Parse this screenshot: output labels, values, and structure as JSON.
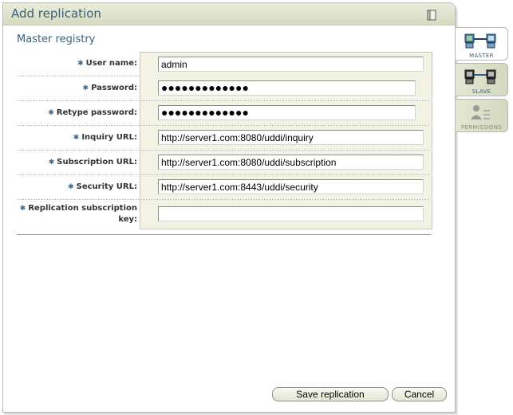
{
  "header": {
    "title": "Add replication",
    "icon": "document-icon"
  },
  "section": {
    "title": "Master registry"
  },
  "form": {
    "rows": [
      {
        "label": "User name:",
        "value": "admin",
        "type": "text"
      },
      {
        "label": "Password:",
        "value": "●●●●●●●●●●●●●",
        "type": "password"
      },
      {
        "label": "Retype password:",
        "value": "●●●●●●●●●●●●●",
        "type": "password"
      },
      {
        "label": "Inquiry URL:",
        "value": "http://server1.com:8080/uddi/inquiry",
        "type": "text"
      },
      {
        "label": "Subscription URL:",
        "value": "http://server1.com:8080/uddi/subscription",
        "type": "text"
      },
      {
        "label": "Security URL:",
        "value": "http://server1.com:8443/uddi/security",
        "type": "text"
      },
      {
        "label_line1": "Replication subscription",
        "label_line2": "key:",
        "value": "",
        "type": "text"
      }
    ],
    "required_marker": "✱"
  },
  "buttons": {
    "save": "Save replication",
    "cancel": "Cancel"
  },
  "tabs": [
    {
      "label": "MASTER",
      "state": "active",
      "icon": "master-servers-icon"
    },
    {
      "label": "SLAVE",
      "state": "inactive",
      "icon": "slave-servers-icon"
    },
    {
      "label": "PERMISSIONS",
      "state": "disabled",
      "icon": "permissions-icon"
    }
  ],
  "colors": {
    "title": "#3d5e74",
    "header_bg": "#dcdfc8",
    "field_bg": "#f2f2e5",
    "required": "#3e6a8e"
  }
}
